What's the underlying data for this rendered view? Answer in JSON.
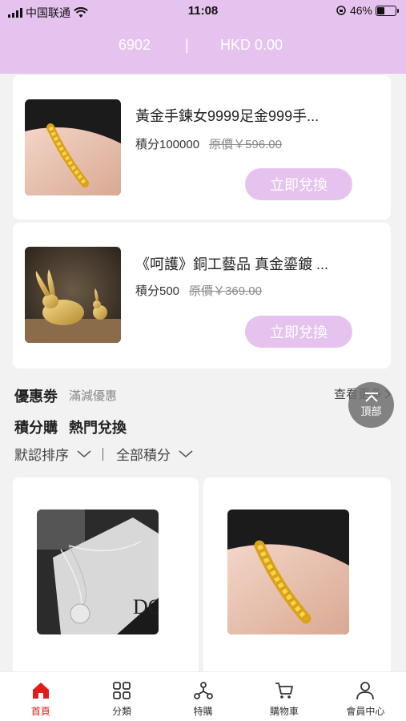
{
  "status_bar": {
    "carrier": "中国联通",
    "time": "11:08",
    "battery": "46%",
    "battery_level": 0.46
  },
  "header": {
    "points": "6902",
    "separator": "|",
    "balance": "HKD 0.00"
  },
  "featured_products": [
    {
      "name": "黃金手鍊女9999足金999手...",
      "points": "積分100000",
      "original_price": "原價￥596.00",
      "button": "立即兌換",
      "image": "gold-bracelet"
    },
    {
      "name": "《呵護》銅工藝品 真金鎏鍍 ...",
      "points": "積分500",
      "original_price": "原價￥369.00",
      "button": "立即兌換",
      "image": "gold-rabbit-figurine"
    }
  ],
  "coupon": {
    "title": "優惠劵",
    "subtitle": "滿減優惠",
    "view_more": "查看更多",
    "top_button": "頂部"
  },
  "section_tabs": [
    "積分購",
    "熱門兌換"
  ],
  "filters": {
    "sort": "默認排序",
    "points": "全部積分"
  },
  "grid_products": [
    {
      "image": "silver-necklace"
    },
    {
      "image": "gold-bracelet"
    }
  ],
  "bottom_nav": [
    {
      "label": "首頁",
      "icon": "home-icon",
      "active": true
    },
    {
      "label": "分類",
      "icon": "category-icon",
      "active": false
    },
    {
      "label": "特購",
      "icon": "special-icon",
      "active": false
    },
    {
      "label": "購物車",
      "icon": "cart-icon",
      "active": false
    },
    {
      "label": "會員中心",
      "icon": "user-icon",
      "active": false
    }
  ],
  "colors": {
    "accent": "#e6c3ee",
    "active_nav": "#e21b1b"
  }
}
